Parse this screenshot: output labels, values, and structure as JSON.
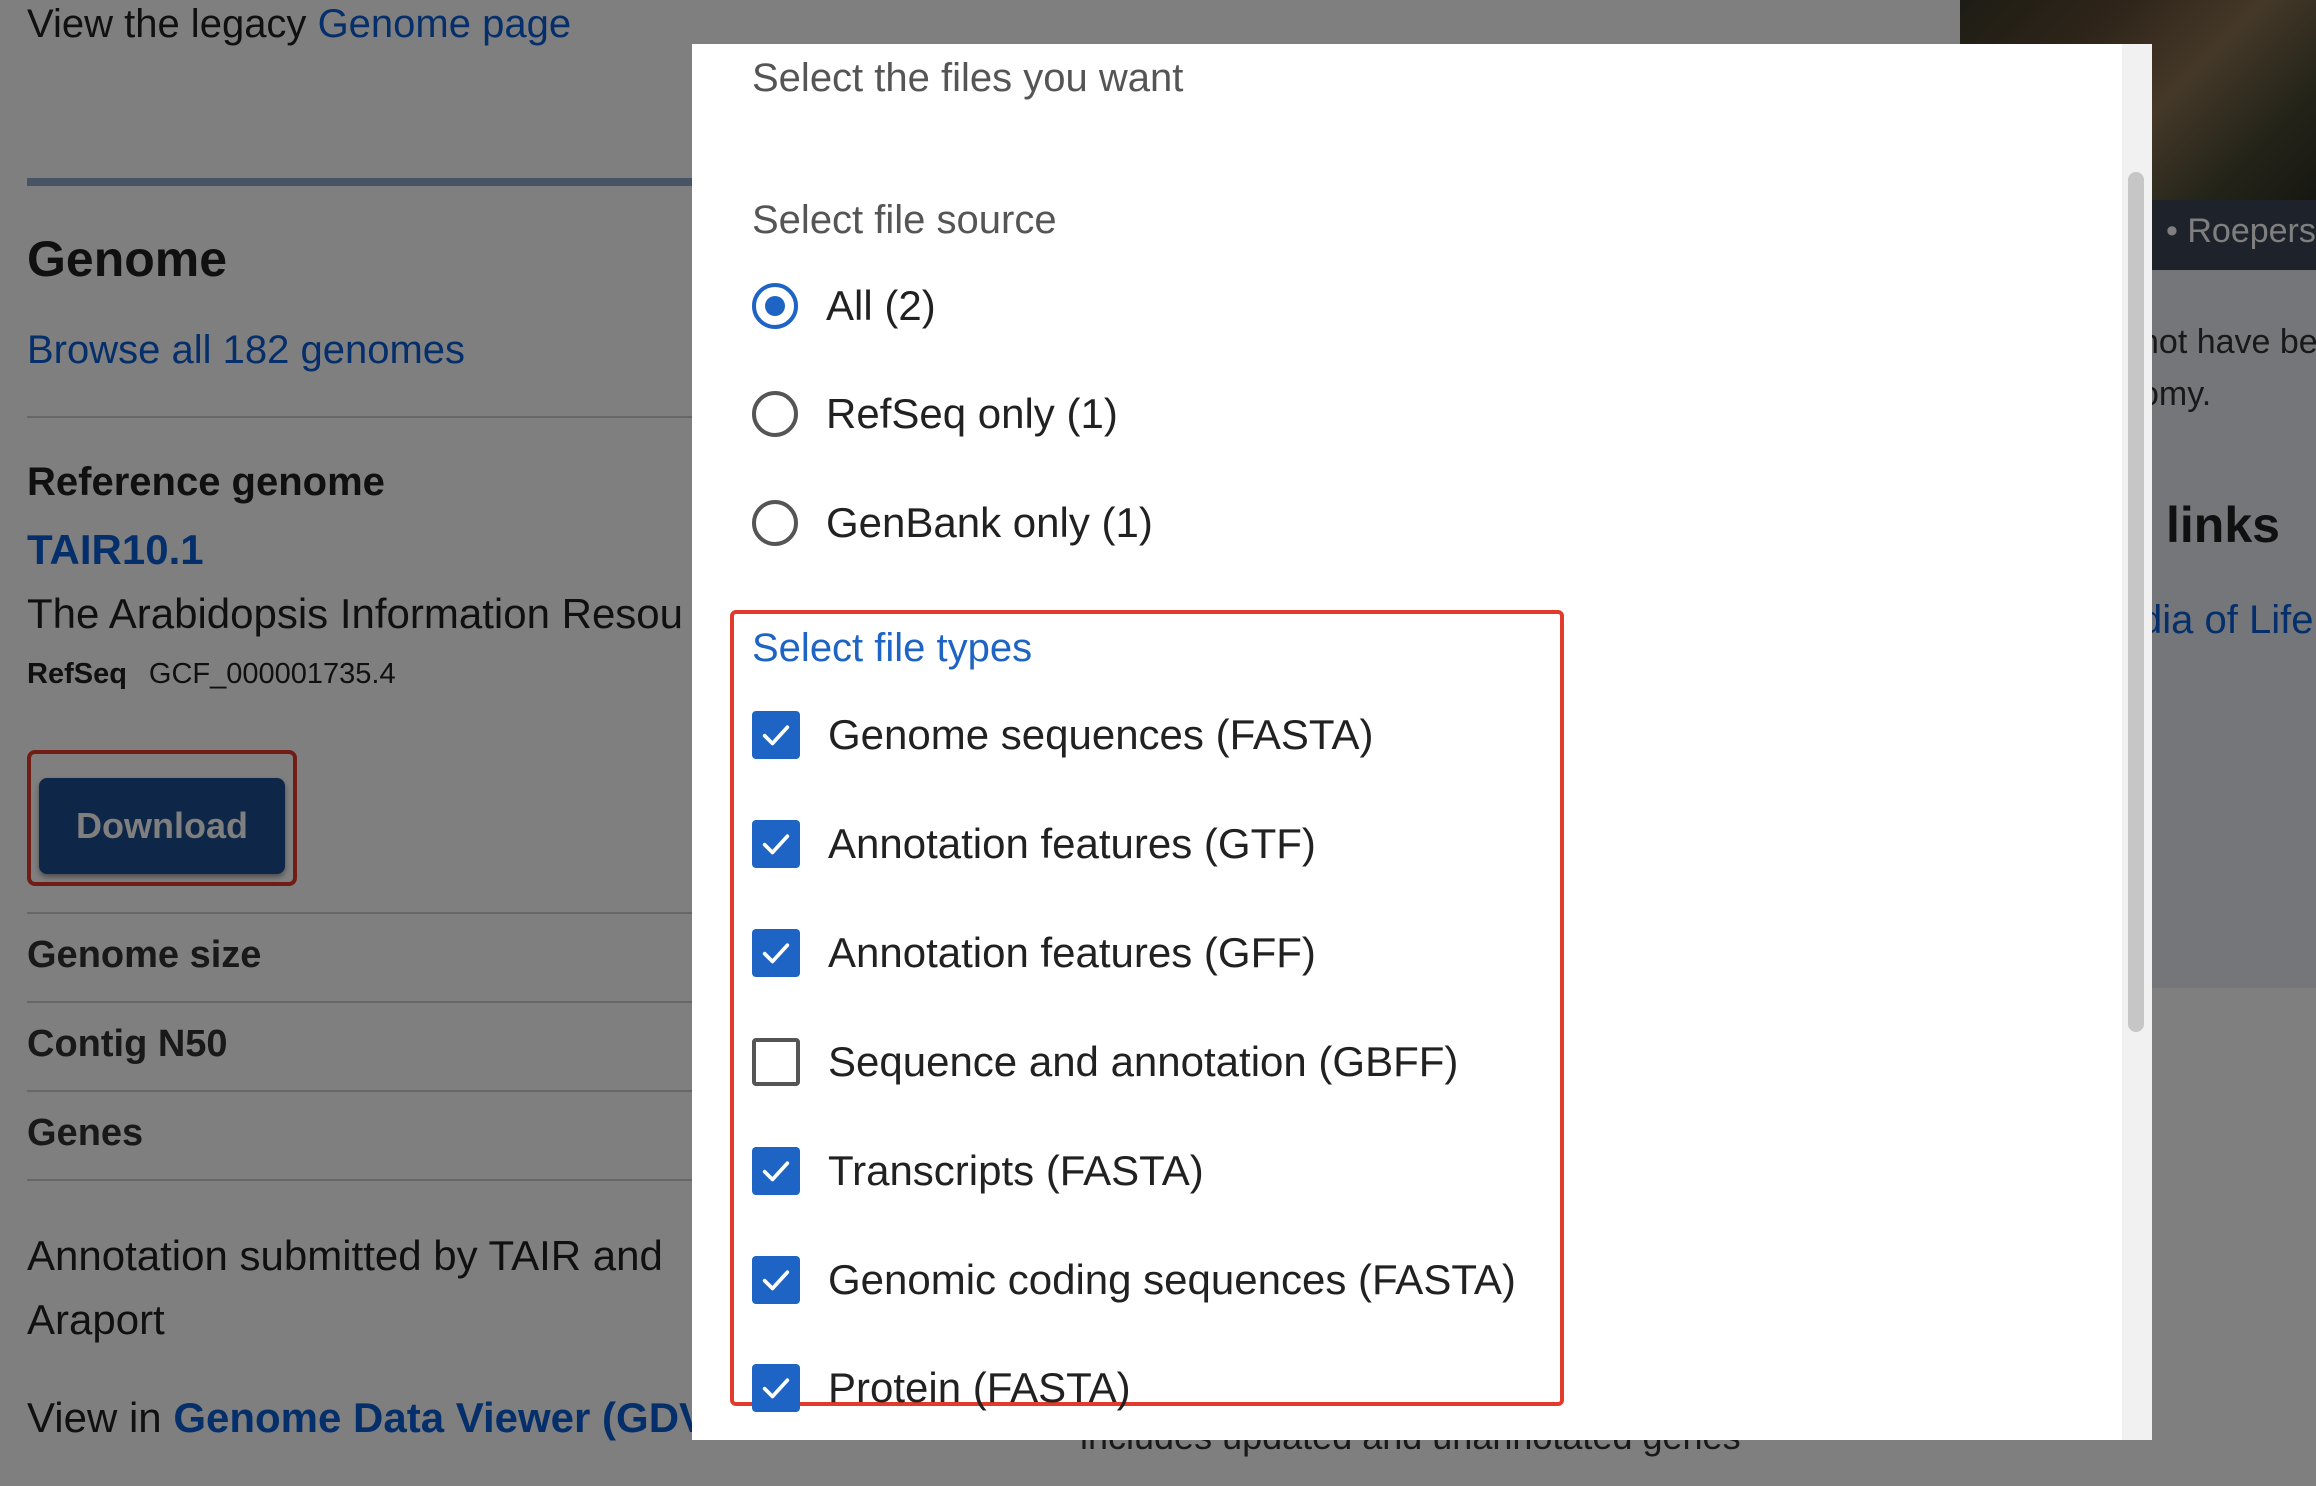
{
  "page": {
    "legacy_prefix": "View the legacy",
    "legacy_link": "Genome page",
    "genome_heading": "Genome",
    "browse_link": "Browse all 182 genomes",
    "ref_heading": "Reference genome",
    "assembly_name": "TAIR10.1",
    "submitter_org": "The Arabidopsis Information Resou",
    "refseq_tag": "RefSeq",
    "refseq_accession": "GCF_000001735.4",
    "download_label": "Download",
    "stats": [
      "Genome size",
      "Contig N50",
      "Genes"
    ],
    "annotation_text": "Annotation submitted by TAIR and Araport",
    "view_in_prefix": "View in",
    "gdv_link": "Genome Data Viewer (GDV",
    "bottom_partial": "includes updated and unannotated genes"
  },
  "sidebar": {
    "photo_caption": "•  Roepers",
    "note_lines": [
      "not have be",
      "omy."
    ],
    "links_heading": "links",
    "eol_link": "dia of Life"
  },
  "modal": {
    "title": "Select the files you want",
    "source_label": "Select file source",
    "sources": [
      {
        "label": "All (2)",
        "selected": true
      },
      {
        "label": "RefSeq only (1)",
        "selected": false
      },
      {
        "label": "GenBank only (1)",
        "selected": false
      }
    ],
    "types_label": "Select file types",
    "file_types": [
      {
        "label": "Genome sequences (FASTA)",
        "checked": true
      },
      {
        "label": "Annotation features (GTF)",
        "checked": true
      },
      {
        "label": "Annotation features (GFF)",
        "checked": true
      },
      {
        "label": "Sequence and annotation (GBFF)",
        "checked": false
      },
      {
        "label": "Transcripts (FASTA)",
        "checked": true
      },
      {
        "label": "Genomic coding sequences (FASTA)",
        "checked": true
      },
      {
        "label": "Protein (FASTA)",
        "checked": true
      }
    ]
  },
  "colors": {
    "accent": "#1d64c4",
    "highlight_box": "#e23b2b",
    "download_button": "#1d4f91",
    "link": "#0b5ed7"
  }
}
